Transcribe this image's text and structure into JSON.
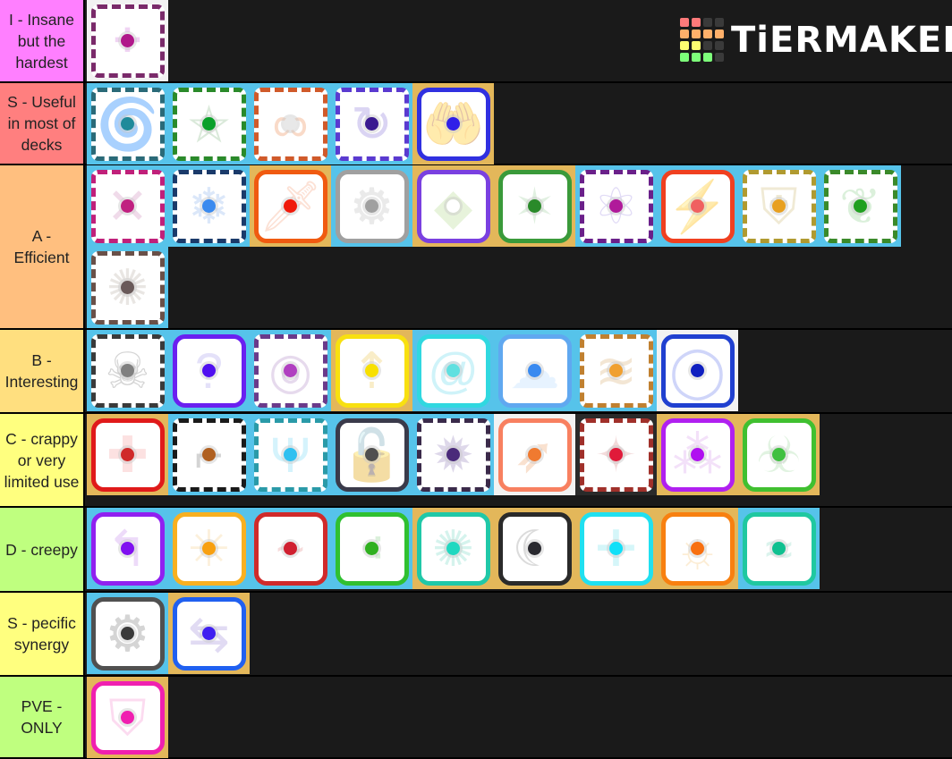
{
  "logo": {
    "text": "TiERMAKER",
    "grid": [
      "#ff7a7a",
      "#ff7a7a",
      "#3a3a3a",
      "#3a3a3a",
      "#ffb06a",
      "#ffb06a",
      "#ffb06a",
      "#ffb06a",
      "#ffff70",
      "#ffff70",
      "#3a3a3a",
      "#3a3a3a",
      "#7dff7a",
      "#7dff7a",
      "#7dff7a",
      "#3a3a3a"
    ]
  },
  "tiers": [
    {
      "label": "I - Insane but the hardest",
      "color": "#ff7fff",
      "height": 93,
      "items": [
        {
          "name": "dotted-pink",
          "bg": "white",
          "border": "#7a2a6a",
          "rough": true,
          "dot": "#b0188a",
          "glyph": "⁘",
          "glyph_color": "#d890e0"
        }
      ]
    },
    {
      "label": "S - Useful in most of decks",
      "color": "#ff7f7f",
      "height": 92,
      "items": [
        {
          "name": "vortex",
          "bg": "blue",
          "border": "#2a6a78",
          "rough": true,
          "dot": "#1f8a9a",
          "glyph": "🌀",
          "glyph_color": "#7fd0e0"
        },
        {
          "name": "pentagram",
          "bg": "blue",
          "border": "#2a8a2a",
          "rough": true,
          "dot": "#0aa02a",
          "glyph": "⛤",
          "glyph_color": "#a0c8a0"
        },
        {
          "name": "infinity",
          "bg": "blue",
          "border": "#d05a2a",
          "rough": true,
          "dot": "#e8e8e8",
          "glyph": "∞",
          "glyph_color": "#f0a070"
        },
        {
          "name": "cycle",
          "bg": "blue",
          "border": "#5a3ad0",
          "rough": true,
          "dot": "#3a1a90",
          "glyph": "↻",
          "glyph_color": "#a090e0"
        },
        {
          "name": "hands",
          "bg": "gold",
          "border": "#3030e0",
          "rough": false,
          "dot": "#3020e8",
          "glyph": "🤲",
          "glyph_color": "#8080e0"
        }
      ]
    },
    {
      "label": "A - Efficient",
      "color": "#ffbf7f",
      "height": 184,
      "items": [
        {
          "name": "syringe",
          "bg": "blue",
          "border": "#c0207a",
          "rough": true,
          "dot": "#c02080",
          "glyph": "✕",
          "glyph_color": "#d8a0c8"
        },
        {
          "name": "snowflake",
          "bg": "blue",
          "border": "#1a3a6a",
          "rough": true,
          "dot": "#3a8aef",
          "glyph": "❄",
          "glyph_color": "#a0c0f0"
        },
        {
          "name": "sword",
          "bg": "gold",
          "border": "#f05a10",
          "rough": false,
          "dot": "#f01a0a",
          "glyph": "🗡",
          "glyph_color": "#f8b090"
        },
        {
          "name": "gear",
          "bg": "blue",
          "border": "#a0a0a0",
          "rough": false,
          "dot": "#a0a0a0",
          "glyph": "⚙",
          "glyph_color": "#c8c8c8"
        },
        {
          "name": "diamonds",
          "bg": "gold",
          "border": "#7a40e0",
          "rough": false,
          "dot": "#ffffff",
          "glyph": "◆",
          "glyph_color": "#c0e0a0"
        },
        {
          "name": "thorns",
          "bg": "gold",
          "border": "#3a9a3a",
          "rough": false,
          "dot": "#2a8a2a",
          "glyph": "✶",
          "glyph_color": "#b0d8b0"
        },
        {
          "name": "atom",
          "bg": "blue",
          "border": "#6a208a",
          "rough": true,
          "dot": "#b01a9a",
          "glyph": "⚛",
          "glyph_color": "#b0a0e8"
        },
        {
          "name": "lightning",
          "bg": "blue",
          "border": "#f04020",
          "rough": false,
          "dot": "#f06060",
          "glyph": "⚡",
          "glyph_color": "#f8b0b0"
        },
        {
          "name": "shield-gold",
          "bg": "blue",
          "border": "#b09a30",
          "rough": true,
          "dot": "#e8a020",
          "glyph": "⛨",
          "glyph_color": "#d8c890"
        },
        {
          "name": "vines",
          "bg": "blue",
          "border": "#3a8a2a",
          "rough": true,
          "dot": "#20a020",
          "glyph": "❦",
          "glyph_color": "#a0d8a0"
        },
        {
          "name": "dust",
          "bg": "blue",
          "border": "#6a5048",
          "rough": true,
          "dot": "#6a5a5a",
          "glyph": "✺",
          "glyph_color": "#c8c0b8"
        }
      ]
    },
    {
      "label": "B - Interesting",
      "color": "#ffdf7f",
      "height": 94,
      "items": [
        {
          "name": "skull",
          "bg": "blue",
          "border": "#3a3a3a",
          "rough": true,
          "dot": "#808080",
          "glyph": "☠",
          "glyph_color": "#909090"
        },
        {
          "name": "question",
          "bg": "blue",
          "border": "#6a20f0",
          "rough": false,
          "dot": "#5010f0",
          "glyph": "?",
          "glyph_color": "#b8b0f0"
        },
        {
          "name": "ring-purple",
          "bg": "blue",
          "border": "#6a3a8a",
          "rough": true,
          "dot": "#b040c0",
          "glyph": "◎",
          "glyph_color": "#c0a0d0"
        },
        {
          "name": "arrows-up",
          "bg": "gold",
          "border": "#f8e010",
          "rough": false,
          "dot": "#f8e000",
          "glyph": "⇡",
          "glyph_color": "#f0d070"
        },
        {
          "name": "swirls",
          "bg": "blue",
          "border": "#30d8e0",
          "rough": false,
          "dot": "#60e0e0",
          "glyph": "@",
          "glyph_color": "#80e0f0"
        },
        {
          "name": "cloud",
          "bg": "blue",
          "border": "#60a8f0",
          "rough": false,
          "dot": "#3a8af0",
          "glyph": "☁",
          "glyph_color": "#c0e0ff"
        },
        {
          "name": "sand",
          "bg": "blue",
          "border": "#c08030",
          "rough": true,
          "dot": "#f0a030",
          "glyph": "≋",
          "glyph_color": "#e0c090"
        },
        {
          "name": "bubbles",
          "bg": "white",
          "border": "#2040d0",
          "rough": false,
          "dot": "#1020c0",
          "glyph": "◯",
          "glyph_color": "#8090f0"
        }
      ]
    },
    {
      "label": "C - crappy or very limited use",
      "color": "#ffff7f",
      "height": 105,
      "items": [
        {
          "name": "plus-red",
          "bg": "gold",
          "border": "#e01a1a",
          "rough": false,
          "dot": "#d02a2a",
          "glyph": "✚",
          "glyph_color": "#f8b0b0"
        },
        {
          "name": "pistol",
          "bg": "blue",
          "border": "#1a1a1a",
          "rough": true,
          "dot": "#b06020",
          "glyph": "⌐",
          "glyph_color": "#909090"
        },
        {
          "name": "ice-trident",
          "bg": "blue",
          "border": "#2a9aa8",
          "rough": true,
          "dot": "#30c0f0",
          "glyph": "Ψ",
          "glyph_color": "#90e0f8"
        },
        {
          "name": "lock",
          "bg": "blue",
          "border": "#3a3a4a",
          "rough": false,
          "dot": "#505050",
          "glyph": "🔓",
          "glyph_color": "#909090"
        },
        {
          "name": "smoke",
          "bg": "blue",
          "border": "#3a2a4a",
          "rough": true,
          "dot": "#4a2a7a",
          "glyph": "✹",
          "glyph_color": "#a898c8"
        },
        {
          "name": "bow",
          "bg": "white",
          "border": "#f88060",
          "rough": false,
          "dot": "#f07a30",
          "glyph": "➶",
          "glyph_color": "#f0b080"
        },
        {
          "name": "compass-star",
          "bg": "black",
          "border": "#a0302a",
          "rough": true,
          "dot": "#e01a3a",
          "glyph": "✦",
          "glyph_color": "#e0a0a0"
        },
        {
          "name": "sparkle-purple",
          "bg": "gold",
          "border": "#b020f0",
          "rough": false,
          "dot": "#b010f0",
          "glyph": "⁂",
          "glyph_color": "#e0b0f0"
        },
        {
          "name": "biohazard",
          "bg": "gold",
          "border": "#40c030",
          "rough": false,
          "dot": "#40c040",
          "glyph": "☣",
          "glyph_color": "#b0e0b0"
        }
      ]
    },
    {
      "label": "D - creepy",
      "color": "#bfff7f",
      "height": 95,
      "items": [
        {
          "name": "turn-arrows",
          "bg": "blue",
          "border": "#9020f0",
          "rough": false,
          "dot": "#8010f0",
          "glyph": "↰",
          "glyph_color": "#d0a0f0"
        },
        {
          "name": "crackle-orange",
          "bg": "blue",
          "border": "#f8b020",
          "rough": false,
          "dot": "#f8a010",
          "glyph": "✳",
          "glyph_color": "#f8d8a0"
        },
        {
          "name": "flame-red",
          "bg": "blue",
          "border": "#d02a2a",
          "rough": false,
          "dot": "#d02030",
          "glyph": "~",
          "glyph_color": "#e8a0a0"
        },
        {
          "name": "slime",
          "bg": "blue",
          "border": "#30c030",
          "rough": false,
          "dot": "#30b020",
          "glyph": "⁖",
          "glyph_color": "#a0d8a0"
        },
        {
          "name": "burst-teal",
          "bg": "gold",
          "border": "#20c8a8",
          "rough": false,
          "dot": "#20d8c0",
          "glyph": "✺",
          "glyph_color": "#90e0d0"
        },
        {
          "name": "scythe",
          "bg": "gold",
          "border": "#2a2a2a",
          "rough": false,
          "dot": "#2a2a30",
          "glyph": "☾",
          "glyph_color": "#a0a0a0"
        },
        {
          "name": "plus-cyan",
          "bg": "gold",
          "border": "#20e0f0",
          "rough": false,
          "dot": "#10e0f8",
          "glyph": "✛",
          "glyph_color": "#90e8f0"
        },
        {
          "name": "sun-orange",
          "bg": "gold",
          "border": "#f88010",
          "rough": false,
          "dot": "#f87010",
          "glyph": "☼",
          "glyph_color": "#f8d090"
        },
        {
          "name": "wave-teal",
          "bg": "blue",
          "border": "#20c8a0",
          "rough": false,
          "dot": "#10c090",
          "glyph": "≈",
          "glyph_color": "#a0e0d0"
        }
      ]
    },
    {
      "label": "S - pecific synergy",
      "color": "#ffff7f",
      "height": 94,
      "items": [
        {
          "name": "gears",
          "bg": "blue",
          "border": "#505050",
          "rough": false,
          "dot": "#3a3a3a",
          "glyph": "⚙",
          "glyph_color": "#909090"
        },
        {
          "name": "swap-arrows",
          "bg": "gold",
          "border": "#2060f0",
          "rough": false,
          "dot": "#4020f0",
          "glyph": "⇆",
          "glyph_color": "#b0a0e0"
        }
      ]
    },
    {
      "label": "PVE - ONLY",
      "color": "#bfff7f",
      "height": 92,
      "items": [
        {
          "name": "broken-shield",
          "bg": "gold",
          "border": "#f020b0",
          "rough": false,
          "dot": "#f020b0",
          "glyph": "⛉",
          "glyph_color": "#f8a0d8"
        }
      ]
    }
  ]
}
